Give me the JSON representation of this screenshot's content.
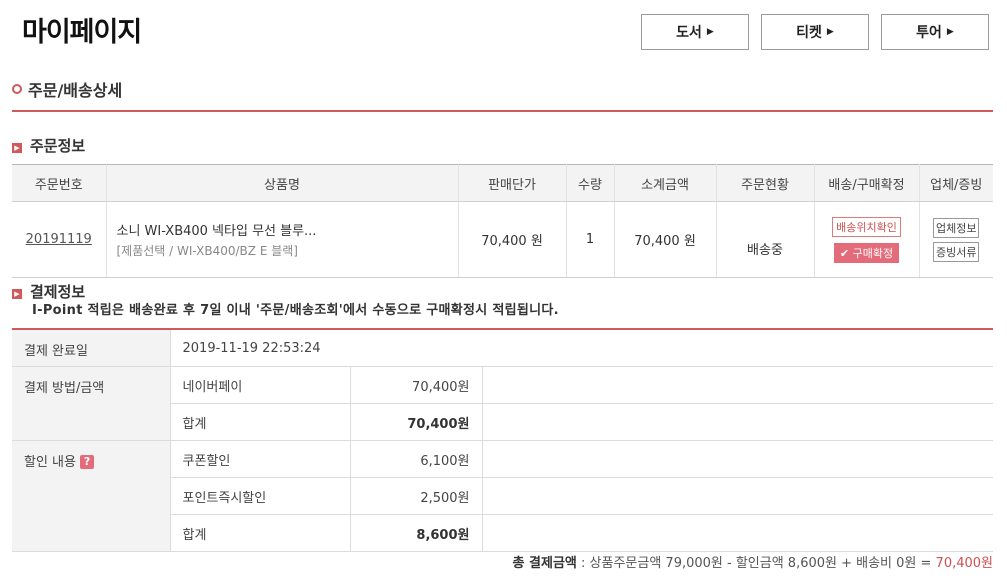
{
  "page_title": "마이페이지",
  "nav": [
    {
      "label": "도서"
    },
    {
      "label": "티켓"
    },
    {
      "label": "투어"
    }
  ],
  "section_title": "주문/배송상세",
  "order_info": {
    "heading": "주문정보",
    "columns": [
      "주문번호",
      "상품명",
      "판매단가",
      "수량",
      "소계금액",
      "주문현황",
      "배송/구매확정",
      "업체/증빙"
    ],
    "row": {
      "order_no": "20191119",
      "product_name": "소니 WI-XB400 넥타입 무선 블루...",
      "product_option": "[제품선택 / WI-XB400/BZ E 블랙]",
      "unit_price": "70,400 원",
      "qty": "1",
      "subtotal": "70,400 원",
      "status": "배송중",
      "track_btn": "배송위치확인",
      "confirm_btn": "✔ 구매확정",
      "vendor_btn": "업체정보",
      "receipt_btn": "증빙서류"
    }
  },
  "payment_info": {
    "heading": "결제정보",
    "notice": "I-Point 적립은 배송완료 후 7일 이내 '주문/배송조회'에서 수동으로 구매확정시 적립됩니다.",
    "completed_label": "결제 완료일",
    "completed_value": "2019-11-19 22:53:24",
    "method_label": "결제 방법/금액",
    "method_rows": [
      {
        "name": "네이버페이",
        "amount": "70,400원"
      },
      {
        "name": "합계",
        "amount": "70,400원"
      }
    ],
    "discount_label": "할인 내용",
    "help_icon": "?",
    "discount_rows": [
      {
        "name": "쿠폰할인",
        "amount": "6,100원"
      },
      {
        "name": "포인트즉시할인",
        "amount": "2,500원"
      },
      {
        "name": "합계",
        "amount": "8,600원"
      }
    ]
  },
  "total": {
    "label": "총 결제금액",
    "sep": " : ",
    "formula": "상품주문금액 79,000원 - 할인금액 8,600원 + 배송비 0원 = ",
    "final": "70,400원"
  },
  "colors": {
    "accent": "#d05a5a",
    "confirm": "#e36b7a"
  }
}
